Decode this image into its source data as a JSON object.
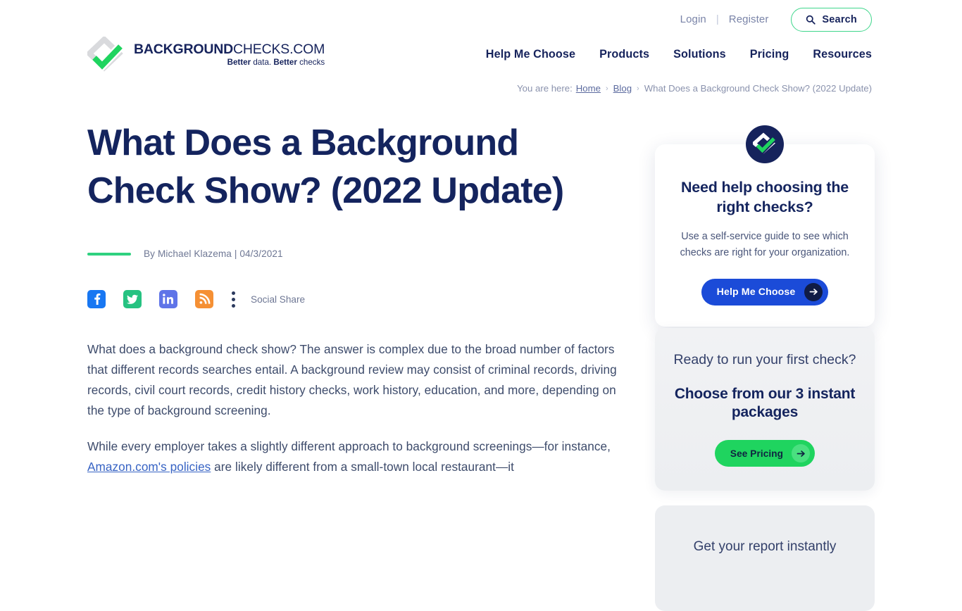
{
  "brand": {
    "logo_line1_bold": "BACKGROUND",
    "logo_line1_light": "CHECKS.COM",
    "tagline_a": "Better",
    "tagline_b": " data. ",
    "tagline_c": "Better",
    "tagline_d": " checks",
    "accent_green": "#2fd180",
    "navy": "#16235c",
    "blue": "#1b4bd8"
  },
  "topbar": {
    "login": "Login",
    "separator": "|",
    "register": "Register",
    "search_label": "Search"
  },
  "nav": {
    "items": [
      {
        "label": "Help Me Choose"
      },
      {
        "label": "Products"
      },
      {
        "label": "Solutions"
      },
      {
        "label": "Pricing"
      },
      {
        "label": "Resources"
      }
    ]
  },
  "breadcrumb": {
    "prefix": "You are here:",
    "home": "Home",
    "blog": "Blog",
    "current": "What Does a Background Check Show? (2022 Update)",
    "sep": "›"
  },
  "article": {
    "title": "What Does a Background Check Show? (2022 Update)",
    "byline": "By Michael Klazema | 04/3/2021",
    "social_share_label": "Social Share",
    "social_icons": [
      {
        "name": "facebook-icon",
        "color": "#1877f2"
      },
      {
        "name": "twitter-icon",
        "color": "#26c281"
      },
      {
        "name": "linkedin-icon",
        "color": "#5f74e8"
      },
      {
        "name": "rss-icon",
        "color": "#f59034"
      }
    ],
    "paragraph1": "What does a background check show? The answer is complex due to the broad number of factors that different records searches entail. A background review may consist of criminal records, driving records, civil court records, credit history checks, work history, education, and more, depending on the type of background screening.",
    "paragraph2_before": "While every employer takes a slightly different approach to background screenings—for instance, ",
    "paragraph2_link": "Amazon.com's policies",
    "paragraph2_after": " are likely different from a small-town local restaurant—it"
  },
  "sidebar": {
    "card1": {
      "heading": "Need help choosing the right checks?",
      "body": "Use a self-service guide to see which checks are right for your organization.",
      "button": "Help Me Choose"
    },
    "card2": {
      "heading": "Ready to run your first check?",
      "subheading": "Choose from our 3 instant packages",
      "button": "See Pricing"
    },
    "card3": {
      "heading": "Get your report instantly"
    }
  }
}
